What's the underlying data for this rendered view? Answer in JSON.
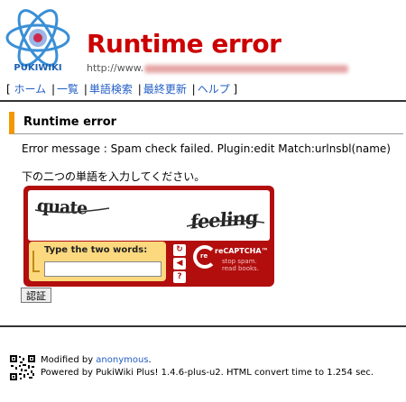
{
  "header": {
    "logo_text": "PUKIWIKI",
    "title": "Runtime error",
    "url_prefix": "http://www."
  },
  "nav": {
    "open_bracket": "[",
    "close_bracket": "]",
    "separator": "|",
    "items": [
      "ホーム",
      "一覧",
      "単語検索",
      "最終更新",
      "ヘルプ"
    ]
  },
  "content": {
    "heading": "Runtime error",
    "error_message": "Error message : Spam check failed. Plugin:edit Match:urlnsbl(name)",
    "prompt": "下の二つの単語を入力してください。"
  },
  "captcha": {
    "word1": "quate",
    "word2": "feeling",
    "label": "Type the two words:",
    "input_value": "",
    "brand": "reCAPTCHA™",
    "brand_re": "re",
    "tagline1": "stop spam.",
    "tagline2": "read books.",
    "refresh_icon": "refresh-icon",
    "audio_icon": "audio-icon",
    "help_icon": "help-icon"
  },
  "form": {
    "submit_label": "認証"
  },
  "footer": {
    "modified_prefix": "Modified by ",
    "modified_by": "anonymous",
    "modified_suffix": ".",
    "powered": "Powered by PukiWiki Plus! 1.4.6-plus-u2. HTML convert time to 1.254 sec."
  },
  "colors": {
    "title": "#cc0000",
    "link": "#215dc6",
    "captcha": "#b20e0e",
    "heading_accent": "#f39800"
  }
}
